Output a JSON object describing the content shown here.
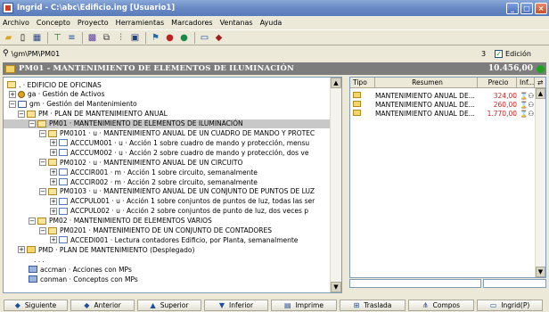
{
  "window": {
    "title": "Ingrid - C:\\abc\\Edificio.ing [Usuario1]"
  },
  "menu": [
    "Archivo",
    "Concepto",
    "Proyecto",
    "Herramientas",
    "Marcadores",
    "Ventanas",
    "Ayuda"
  ],
  "toolbar_icons": [
    "open-folder-icon",
    "new-doc-icon",
    "save-icon",
    "filter-icon",
    "list-icon",
    "grid-icon",
    "copy-icon",
    "tree-icon",
    "tools-icon",
    "palette-icon",
    "globe-icon",
    "window-icon",
    "settings-icon"
  ],
  "pathbar": {
    "path": "\\gm\\PM\\PM01",
    "count": "3",
    "edicion_label": "Edición",
    "edicion_checked": "✓"
  },
  "header": {
    "title": "PM01 - MANTENIMIENTO DE ELEMENTOS DE ILUMINACIÓN",
    "amount": "10.456,00"
  },
  "tree": [
    {
      "text": ". · EDIFICIO DE OFICINAS",
      "toggle": "",
      "icon": "open"
    },
    {
      "text": "ga · Gestión de Activos",
      "toggle": "+",
      "icon": "act"
    },
    {
      "text": "gm · Gestión del Mantenimiento",
      "toggle": "−",
      "icon": "uni"
    },
    {
      "text": "PM · PLAN DE MANTENIMIENTO ANUAL",
      "toggle": "−",
      "icon": "open"
    },
    {
      "text": "PM01 · MANTENIMIENTO DE ELEMENTOS DE ILUMINACIÓN",
      "toggle": "−",
      "icon": "open"
    },
    {
      "text": "PM0101 · u · MANTENIMIENTO ANUAL DE UN CUADRO DE MANDO Y PROTEC",
      "toggle": "−",
      "icon": "open"
    },
    {
      "text": "ACCCUM001 · u · Acción 1 sobre cuadro de mando y protección, mensu",
      "toggle": "+",
      "icon": "doc"
    },
    {
      "text": "ACCCUM002 · u · Acción 2 sobre cuadro de mando y protección, dos ve",
      "toggle": "+",
      "icon": "doc"
    },
    {
      "text": "PM0102 · u · MANTENIMIENTO ANUAL DE UN CIRCUITO",
      "toggle": "−",
      "icon": "open"
    },
    {
      "text": "ACCCIR001 · m · Acción 1 sobre circuito, semanalmente",
      "toggle": "+",
      "icon": "doc"
    },
    {
      "text": "ACCCIR002 · m · Acción 2 sobre circuito, semanalmente",
      "toggle": "+",
      "icon": "doc"
    },
    {
      "text": "PM0103 · u · MANTENIMIENTO ANUAL DE UN CONJUNTO DE PUNTOS DE LUZ",
      "toggle": "−",
      "icon": "open"
    },
    {
      "text": "ACCPUL001 · u · Acción 1 sobre conjuntos de puntos de luz, todas las ser",
      "toggle": "+",
      "icon": "doc"
    },
    {
      "text": "ACCPUL002 · u · Acción 2 sobre conjuntos de punto de luz, dos veces p",
      "toggle": "+",
      "icon": "doc"
    },
    {
      "text": "PM02 · MANTENIMIENTO DE ELEMENTOS VARIOS",
      "toggle": "−",
      "icon": "open"
    },
    {
      "text": "PM0201 · MANTENIMIENTO DE UN CONJUNTO DE CONTADORES",
      "toggle": "−",
      "icon": "open"
    },
    {
      "text": "ACCEDI001 · Lectura contadores Edificio, por Planta, semanalmente",
      "toggle": "+",
      "icon": "doc"
    },
    {
      "text": "PMD · PLAN DE MANTENIMIENTO (Desplegado)",
      "toggle": "+",
      "icon": "fold"
    },
    {
      "text": ". . .",
      "toggle": "",
      "icon": "none"
    },
    {
      "text": "accman · Acciones con MPs",
      "toggle": "",
      "icon": "doc-u"
    },
    {
      "text": "conman · Conceptos con MPs",
      "toggle": "",
      "icon": "doc-u"
    }
  ],
  "grid": {
    "headers": [
      "Tipo",
      "Resumen",
      "Precio",
      "Inf..."
    ],
    "rows": [
      {
        "resumen": "MANTENIMIENTO ANUAL DE...",
        "precio": "324,00"
      },
      {
        "resumen": "MANTENIMIENTO ANUAL DE...",
        "precio": "260,00"
      },
      {
        "resumen": "MANTENIMIENTO ANUAL DE...",
        "precio": "1.770,00"
      }
    ]
  },
  "bottom_buttons": [
    {
      "label": "Siguiente",
      "icon": "◆"
    },
    {
      "label": "Anterior",
      "icon": "◆"
    },
    {
      "label": "Superior",
      "icon": "▲"
    },
    {
      "label": "Inferior",
      "icon": "▼"
    },
    {
      "label": "Imprime",
      "icon": "▤"
    },
    {
      "label": "Traslada",
      "icon": "⊞"
    },
    {
      "label": "Compos",
      "icon": "⋔"
    },
    {
      "label": "Ingrid(P)",
      "icon": "▭"
    }
  ]
}
